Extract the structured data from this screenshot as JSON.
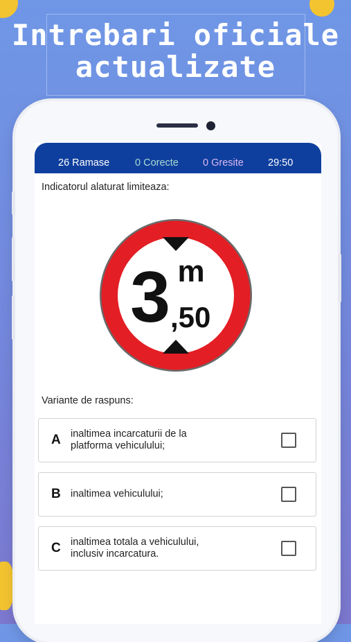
{
  "promo": {
    "headline_line1": "Intrebari oficiale",
    "headline_line2": "actualizate"
  },
  "quiz": {
    "status": {
      "remaining": "26 Ramase",
      "correct": "0 Corecte",
      "wrong": "0 Gresite",
      "timer": "29:50"
    },
    "question": "Indicatorul alaturat limiteaza:",
    "sign": {
      "icon": "height-limit-sign-icon",
      "main_number": "3",
      "unit": "m",
      "decimal": ",50",
      "ring_color": "#e31e24"
    },
    "answers_title": "Variante de raspuns:",
    "options": [
      {
        "letter": "A",
        "text": "inaltimea incarcaturii de la\nplatforma vehiculului;",
        "checked": false
      },
      {
        "letter": "B",
        "text": "inaltimea vehiculului;",
        "checked": false
      },
      {
        "letter": "C",
        "text": "inaltimea totala a vehiculului,\ninclusiv incarcatura.",
        "checked": false
      }
    ]
  },
  "colors": {
    "header_blue": "#0f3f9e",
    "accent_yellow": "#f4c430",
    "correct_teal": "#a9dcd2",
    "wrong_purple": "#d8b8f0"
  }
}
